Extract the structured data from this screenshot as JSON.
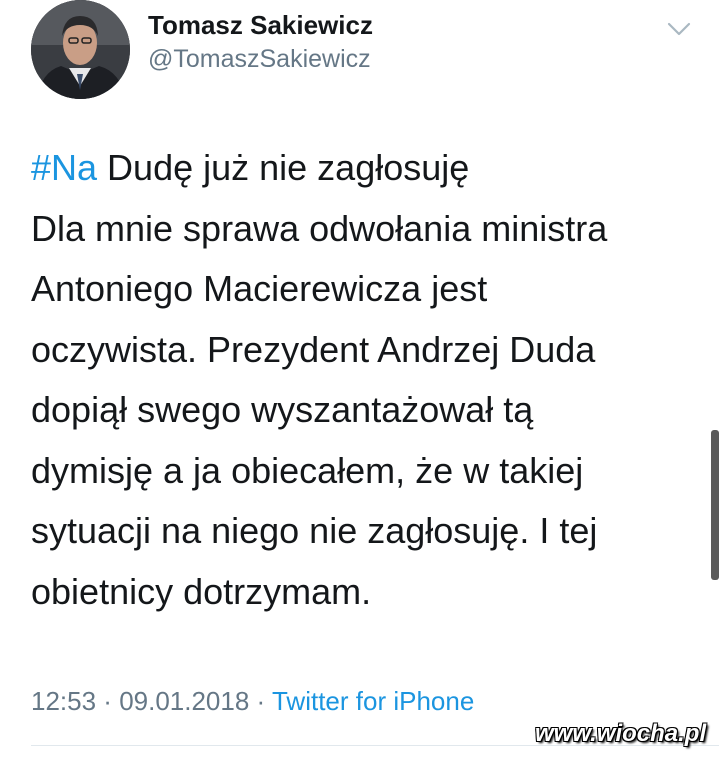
{
  "user": {
    "display_name": "Tomasz Sakiewicz",
    "handle": "@TomaszSakiewicz"
  },
  "tweet": {
    "hashtag": "#Na",
    "lines": [
      " Dudę już nie zagłosuję",
      "Dla mnie sprawa odwołania ministra",
      "Antoniego Macierewicza jest",
      "oczywista. Prezydent Andrzej Duda",
      "dopiął swego wyszantażował tą",
      "dymisję a ja obiecałem, że w takiej",
      "sytuacji na niego nie zagłosuję. I tej",
      "obietnicy dotrzymam."
    ]
  },
  "meta": {
    "time": "12:53",
    "separator": " · ",
    "date": "09.01.2018",
    "source": "Twitter for iPhone"
  },
  "watermark": "www.wiocha.pl",
  "icons": {
    "menu": "chevron-down-icon"
  },
  "colors": {
    "link": "#1b95e0",
    "text": "#14171a",
    "secondary": "#657786",
    "divider": "#e1e8ed"
  }
}
